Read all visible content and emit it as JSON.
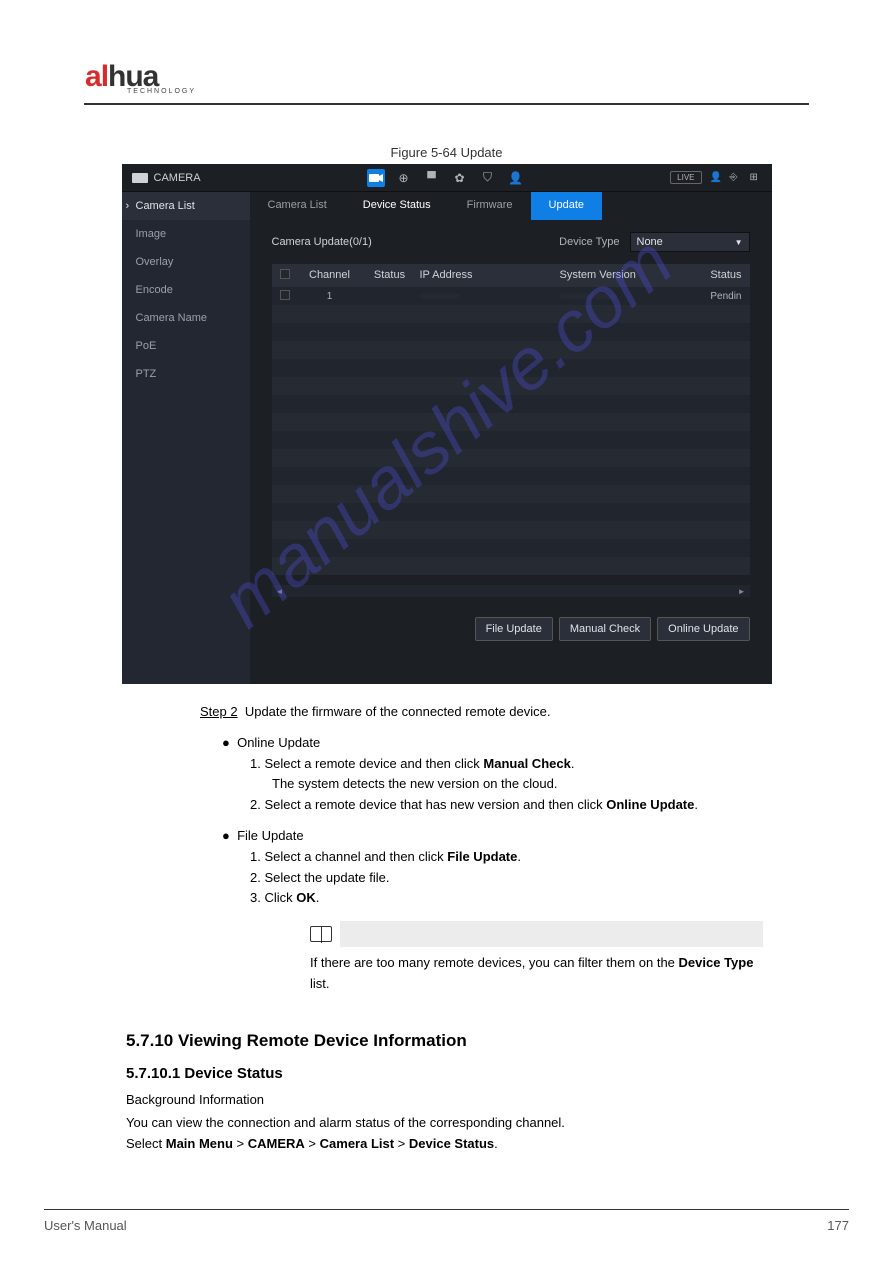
{
  "logo": {
    "text": "alhua",
    "subtext": "TECHNOLOGY"
  },
  "figure_caption": "Figure 5-64 Update",
  "screenshot": {
    "topbar": {
      "title": "CAMERA",
      "live_badge": "LIVE"
    },
    "sidebar": {
      "items": [
        {
          "label": "Camera List",
          "active": true
        },
        {
          "label": "Image"
        },
        {
          "label": "Overlay"
        },
        {
          "label": "Encode"
        },
        {
          "label": "Camera Name"
        },
        {
          "label": "PoE"
        },
        {
          "label": "PTZ"
        }
      ]
    },
    "tabs": {
      "items": [
        {
          "label": "Camera List"
        },
        {
          "label": "Device Status",
          "mid": true
        },
        {
          "label": "Firmware"
        },
        {
          "label": "Update",
          "active": true
        }
      ]
    },
    "heading": {
      "label": "Camera Update(0/1)",
      "device_type_label": "Device Type",
      "device_type_value": "None"
    },
    "table": {
      "headers": {
        "channel": "Channel",
        "status": "Status",
        "ip": "IP Address",
        "sysver": "System Version",
        "status2": "Status"
      },
      "row1": {
        "channel": "1",
        "ip": "············",
        "sysver": "·················",
        "status2": "Pendin"
      }
    },
    "buttons": {
      "file_update": "File Update",
      "manual_check": "Manual Check",
      "online_update": "Online Update"
    }
  },
  "watermark": "manualshive.com",
  "doc": {
    "step2_label": "Step 2",
    "step2_text": "Update the firmware of the connected remote device.",
    "bullet_online": "Online Update",
    "ol1": "1.   Select a remote device and then click ",
    "ol1_btn": "Manual Check",
    "ol1_tail": ".",
    "ol1_sub": "The system detects the new version on the cloud.",
    "ol2": "2.   Select a remote device that has new version and then click ",
    "ol2_btn": "Online Update",
    "ol2_tail": ".",
    "bullet_file": "File Update",
    "fl1": "1.   Select a channel and then click ",
    "fl1_btn": "File Update",
    "fl1_tail": ".",
    "fl2": "2.   Select the update file.",
    "fl3": "3.   Click ",
    "fl3_btn": "OK",
    "fl3_tail": ".",
    "note_text": "If there are too many remote devices, you can filter them on the ",
    "note_bold": "Device Type",
    "note_tail": " list.",
    "h4": "5.7.10 Viewing Remote Device Information",
    "h4_sub": "5.7.10.1 Device Status",
    "bg_intro": "Background Information",
    "bg_body_1": "You can view the connection and alarm status of the corresponding channel.",
    "bg_body_2a": "Select ",
    "bg_body_2b": "Main Menu",
    "bg_body_2c": " > ",
    "bg_body_2d": "CAMERA",
    "bg_body_2e": " > ",
    "bg_body_2f": "Camera List",
    "bg_body_2g": " > ",
    "bg_body_2h": "Device Status",
    "bg_body_2i": "."
  },
  "footer": {
    "left": "User's Manual",
    "right": "177"
  }
}
